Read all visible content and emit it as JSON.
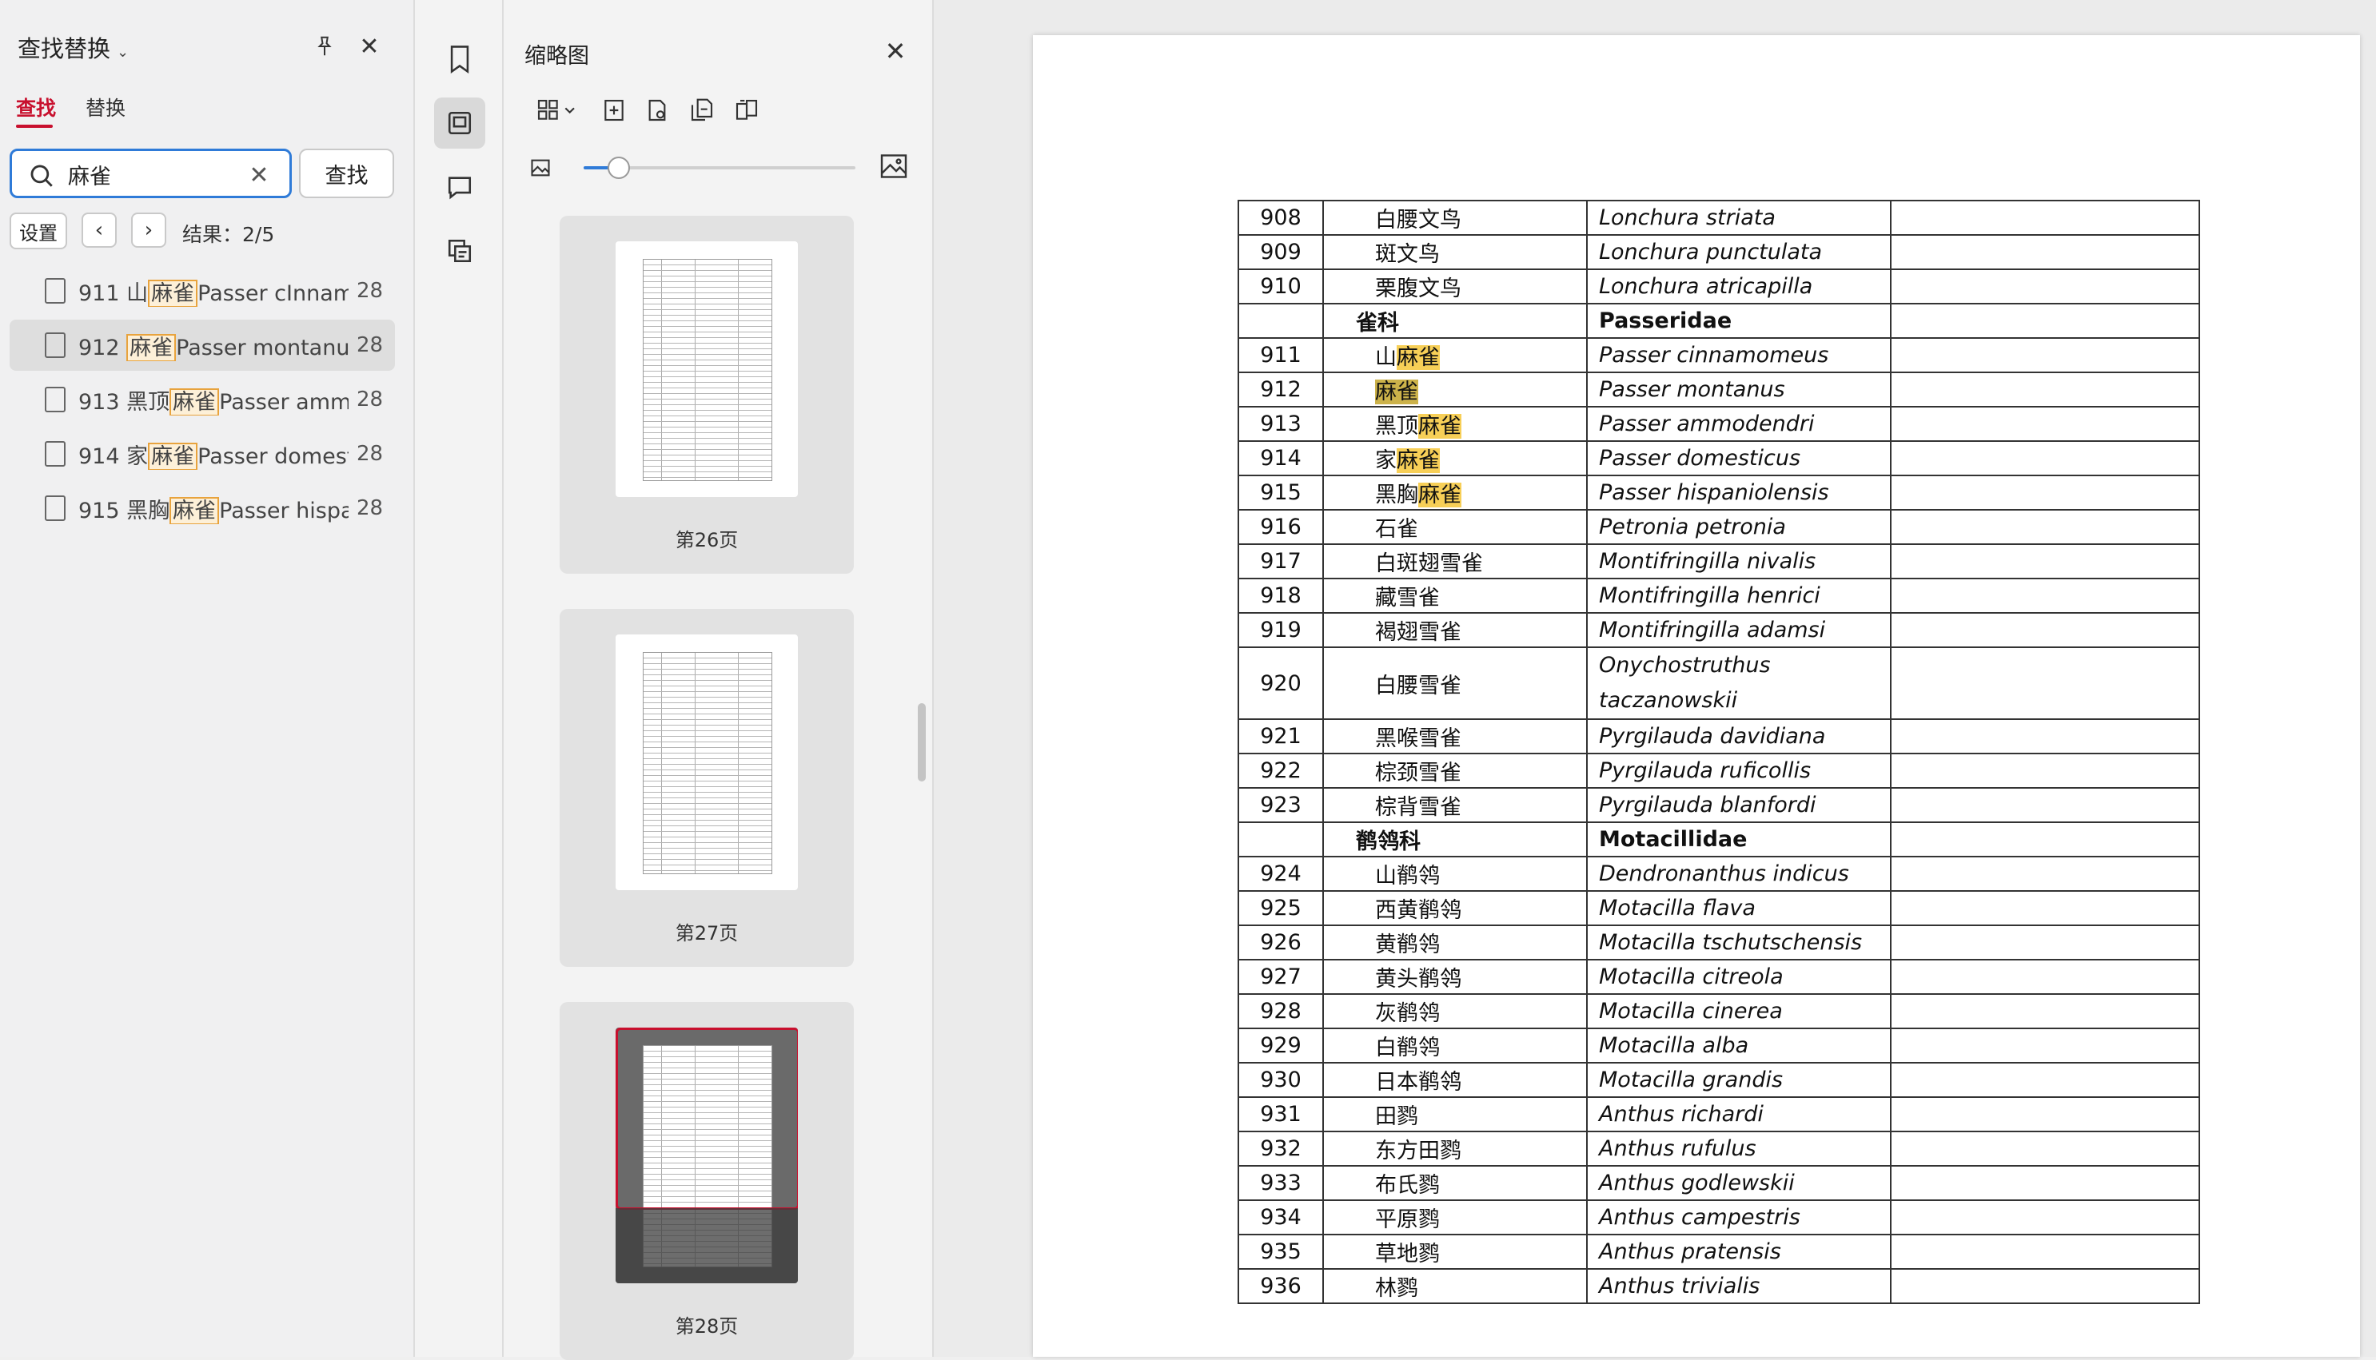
{
  "find_panel": {
    "title": "查找替换",
    "tabs": {
      "find": "查找",
      "replace": "替换"
    },
    "search_value": "麻雀",
    "find_button": "查找",
    "settings_button": "设置",
    "result_text": "结果：2/5",
    "results": [
      {
        "prefix": "911 山",
        "match": "麻雀",
        "suffix": "Passer cInnamomeus",
        "page": "28"
      },
      {
        "prefix": "912 ",
        "match": "麻雀",
        "suffix": "Passer montanus",
        "page": "28"
      },
      {
        "prefix": "913 黑顶",
        "match": "麻雀",
        "suffix": "Passer ammodendri",
        "page": "28"
      },
      {
        "prefix": "914 家",
        "match": "麻雀",
        "suffix": "Passer domesticus",
        "page": "28"
      },
      {
        "prefix": "915 黑胸",
        "match": "麻雀",
        "suffix": "Passer hispaniolensis",
        "page": "28"
      }
    ]
  },
  "thumbnail_panel": {
    "title": "缩略图",
    "thumbnails": [
      {
        "label": "第26页"
      },
      {
        "label": "第27页"
      },
      {
        "label": "第28页"
      }
    ]
  },
  "colors": {
    "accent_red": "#c8102e",
    "focus_blue": "#2f7bd8",
    "highlight": "#f7cf57"
  },
  "table": {
    "rows": [
      {
        "num": "908",
        "cn": "白腰文鸟",
        "sci": "Lonchura striata"
      },
      {
        "num": "909",
        "cn": "斑文鸟",
        "sci": "Lonchura punctulata"
      },
      {
        "num": "910",
        "cn": "栗腹文鸟",
        "sci": "Lonchura atricapilla"
      },
      {
        "num": "",
        "cn": "雀科",
        "sci": "Passeridae",
        "family": true
      },
      {
        "num": "911",
        "cn_pre": "山",
        "cn_hl": "麻雀",
        "sci": "Passer cinnamomeus"
      },
      {
        "num": "912",
        "cn_pre": "",
        "cn_hl": "麻雀",
        "sci": "Passer montanus",
        "current": true
      },
      {
        "num": "913",
        "cn_pre": "黑顶",
        "cn_hl": "麻雀",
        "sci": "Passer ammodendri"
      },
      {
        "num": "914",
        "cn_pre": "家",
        "cn_hl": "麻雀",
        "sci": "Passer domesticus"
      },
      {
        "num": "915",
        "cn_pre": "黑胸",
        "cn_hl": "麻雀",
        "sci": "Passer hispaniolensis"
      },
      {
        "num": "916",
        "cn": "石雀",
        "sci": "Petronia petronia"
      },
      {
        "num": "917",
        "cn": "白斑翅雪雀",
        "sci": "Montifringilla nivalis"
      },
      {
        "num": "918",
        "cn": "藏雪雀",
        "sci": "Montifringilla henrici"
      },
      {
        "num": "919",
        "cn": "褐翅雪雀",
        "sci": "Montifringilla adamsi"
      },
      {
        "num": "920",
        "cn": "白腰雪雀",
        "sci": "Onychostruthus",
        "sci2": "taczanowskii",
        "tall": true
      },
      {
        "num": "921",
        "cn": "黑喉雪雀",
        "sci": "Pyrgilauda davidiana"
      },
      {
        "num": "922",
        "cn": "棕颈雪雀",
        "sci": "Pyrgilauda ruficollis"
      },
      {
        "num": "923",
        "cn": "棕背雪雀",
        "sci": "Pyrgilauda blanfordi"
      },
      {
        "num": "",
        "cn": "鹡鸰科",
        "sci": "Motacillidae",
        "family": true
      },
      {
        "num": "924",
        "cn": "山鹡鸰",
        "sci": "Dendronanthus indicus"
      },
      {
        "num": "925",
        "cn": "西黄鹡鸰",
        "sci": "Motacilla flava"
      },
      {
        "num": "926",
        "cn": "黄鹡鸰",
        "sci": "Motacilla tschutschensis"
      },
      {
        "num": "927",
        "cn": "黄头鹡鸰",
        "sci": "Motacilla citreola"
      },
      {
        "num": "928",
        "cn": "灰鹡鸰",
        "sci": "Motacilla cinerea"
      },
      {
        "num": "929",
        "cn": "白鹡鸰",
        "sci": "Motacilla alba"
      },
      {
        "num": "930",
        "cn": "日本鹡鸰",
        "sci": "Motacilla grandis"
      },
      {
        "num": "931",
        "cn": "田鹨",
        "sci": "Anthus richardi"
      },
      {
        "num": "932",
        "cn": "东方田鹨",
        "sci": "Anthus rufulus"
      },
      {
        "num": "933",
        "cn": "布氏鹨",
        "sci": "Anthus godlewskii"
      },
      {
        "num": "934",
        "cn": "平原鹨",
        "sci": "Anthus campestris"
      },
      {
        "num": "935",
        "cn": "草地鹨",
        "sci": "Anthus pratensis"
      },
      {
        "num": "936",
        "cn": "林鹨",
        "sci": "Anthus trivialis"
      }
    ]
  }
}
